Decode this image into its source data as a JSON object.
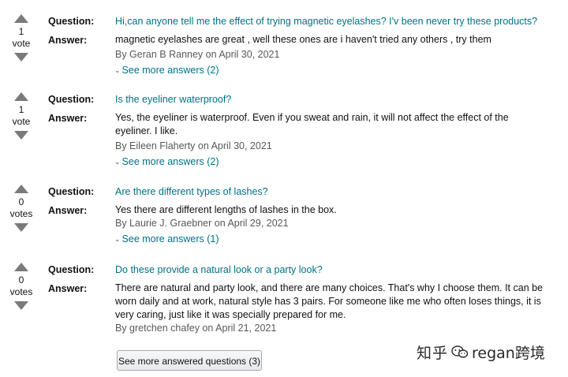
{
  "labels": {
    "question": "Question:",
    "answer": "Answer:"
  },
  "items": [
    {
      "votes": "1",
      "vote_label": "vote",
      "question": "Hi,can anyone tell me the effect of trying magnetic eyelashes? I'v been never try these products?",
      "answer_lines": [
        "magnetic eyelashes are great , well these ones are i haven't tried any others , try them"
      ],
      "byline": "By Geran B Ranney on April 30, 2021",
      "see_more": "See more answers (2)"
    },
    {
      "votes": "1",
      "vote_label": "vote",
      "question": "Is the eyeliner waterproof?",
      "answer_lines": [
        "Yes, the eyeliner is waterproof. Even if you sweat and rain, it will not affect the effect of the",
        "eyeliner. I like."
      ],
      "byline": "By Eileen Flaherty on April 30, 2021",
      "see_more": "See more answers (2)"
    },
    {
      "votes": "0",
      "vote_label": "votes",
      "question": "Are there different types of lashes?",
      "answer_lines": [
        "Yes there are different lengths of lashes in the box."
      ],
      "byline": "By Laurie J. Graebner on April 29, 2021",
      "see_more": "See more answers (1)"
    },
    {
      "votes": "0",
      "vote_label": "votes",
      "question": "Do these provide a natural look or a party look?",
      "answer_lines": [
        "There are natural and party look, and there are many choices. That's why I choose them. It can be",
        "worn daily and at work, natural style has 3 pairs. For someone like me who often loses things, it is",
        "very caring, just like it was specially prepared for me."
      ],
      "byline": "By gretchen chafey on April 21, 2021",
      "see_more": ""
    }
  ],
  "more_button": "See more answered questions (3)",
  "watermark": {
    "left": "知乎",
    "right": "regan跨境"
  },
  "colors": {
    "link": "#007185",
    "byline": "#565959",
    "arrow": "#7a7a7a"
  },
  "icons": [
    "upvote-arrow-icon",
    "downvote-arrow-icon",
    "chevron-down-icon"
  ]
}
